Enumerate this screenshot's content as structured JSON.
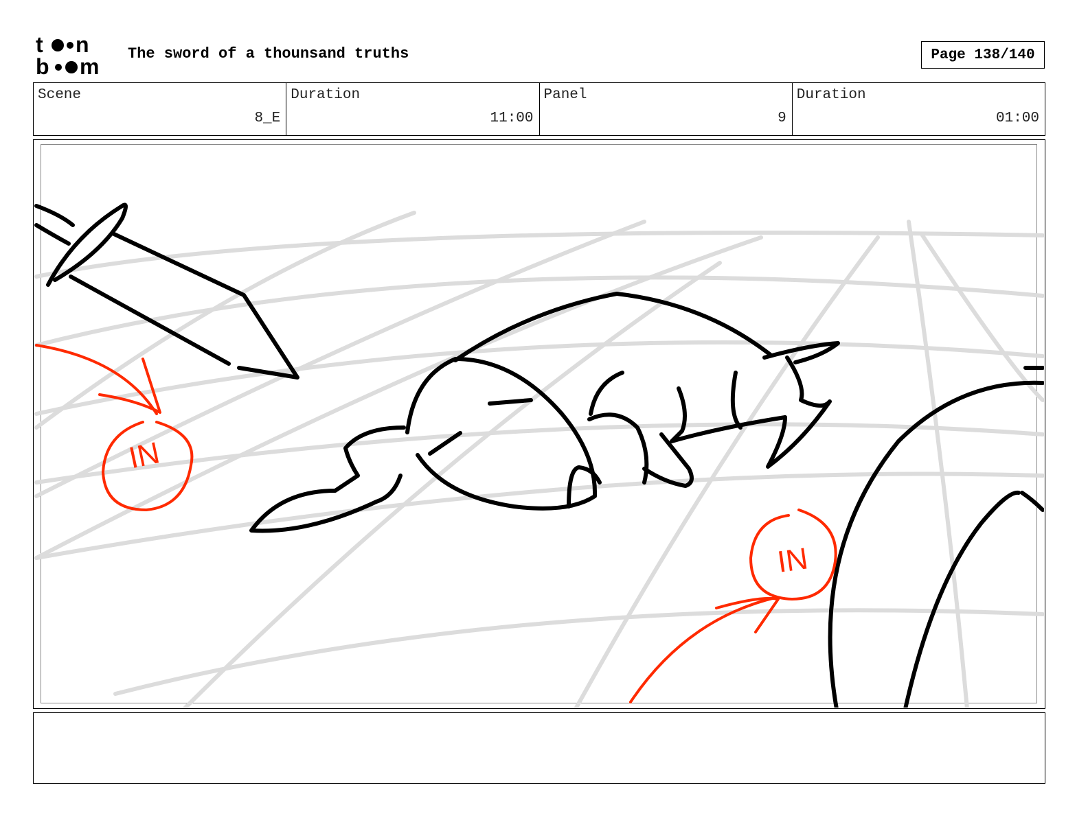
{
  "header": {
    "logo_text": "toon boom",
    "title": "The sword of a thounsand truths",
    "page_label": "Page 138/140"
  },
  "info": {
    "scene_label": "Scene",
    "scene_value": "8_E",
    "scene_duration_label": "Duration",
    "scene_duration_value": "11:00",
    "panel_label": "Panel",
    "panel_value": "9",
    "panel_duration_label": "Duration",
    "panel_duration_value": "01:00"
  },
  "panel": {
    "annotations": [
      "IN",
      "IN"
    ],
    "annotation_color": "#ff2a00",
    "guide_line_color": "#dcdcdc",
    "ink_color": "#000000"
  },
  "notes": {
    "text": ""
  }
}
